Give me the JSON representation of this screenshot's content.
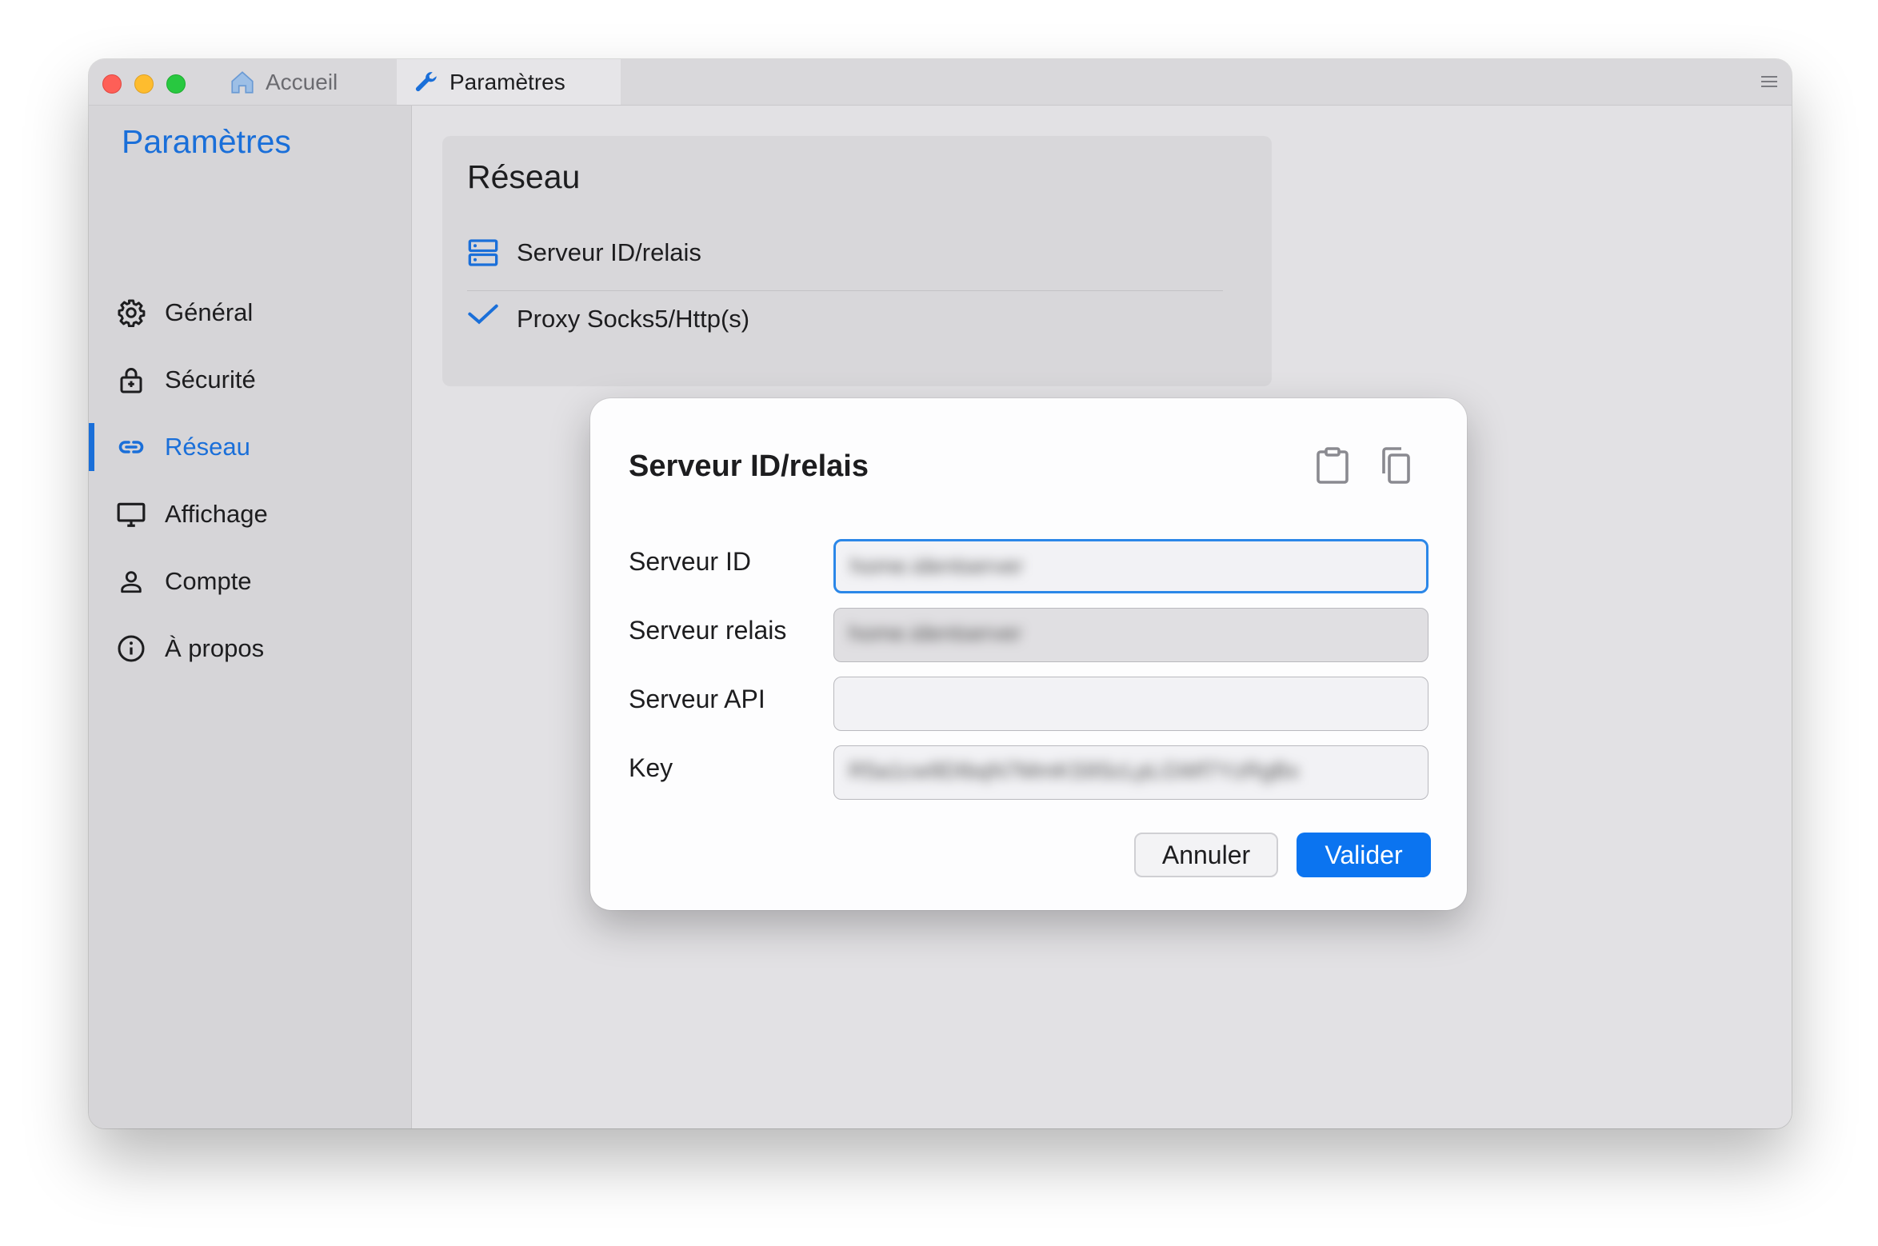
{
  "titlebar": {
    "tabs": [
      {
        "label": "Accueil",
        "icon": "home-icon",
        "active": false
      },
      {
        "label": "Paramètres",
        "icon": "wrench-icon",
        "active": true
      }
    ]
  },
  "sidebar": {
    "title": "Paramètres",
    "items": [
      {
        "label": "Général",
        "icon": "gear-icon",
        "active": false
      },
      {
        "label": "Sécurité",
        "icon": "lock-icon",
        "active": false
      },
      {
        "label": "Réseau",
        "icon": "link-icon",
        "active": true
      },
      {
        "label": "Affichage",
        "icon": "monitor-icon",
        "active": false
      },
      {
        "label": "Compte",
        "icon": "person-icon",
        "active": false
      },
      {
        "label": "À propos",
        "icon": "info-icon",
        "active": false
      }
    ]
  },
  "main": {
    "section_title": "Réseau",
    "items": [
      {
        "label": "Serveur ID/relais",
        "icon": "server-icon"
      },
      {
        "label": "Proxy Socks5/Http(s)",
        "icon": "proxy-icon"
      }
    ]
  },
  "dialog": {
    "title": "Serveur ID/relais",
    "fields": [
      {
        "label": "Serveur ID",
        "value": "home.identserver",
        "state": "focused"
      },
      {
        "label": "Serveur relais",
        "value": "home.identserver",
        "state": "readonly"
      },
      {
        "label": "Serveur API",
        "value": "",
        "state": "normal"
      },
      {
        "label": "Key",
        "value": "R5a1cw9DIbqN7MmKS9ScLpLGWf7YzRgBx",
        "state": "normal"
      }
    ],
    "cancel_label": "Annuler",
    "ok_label": "Valider"
  },
  "colors": {
    "accent": "#1a6fd9",
    "primary_button": "#0b74f0",
    "close": "#fe5f57",
    "minimize": "#febc2e",
    "zoom": "#28c840"
  }
}
